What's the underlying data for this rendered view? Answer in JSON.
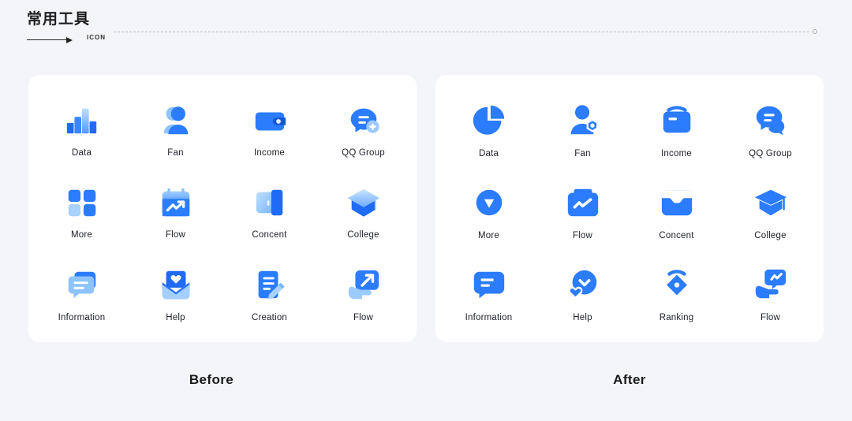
{
  "header": {
    "title": "常用工具",
    "arrow_label": "ICON",
    "end_dot": "circle-marker"
  },
  "panels": {
    "before": {
      "caption": "Before",
      "style": "gradient",
      "icons": [
        {
          "label": "Data",
          "icon": "bar-chart-icon"
        },
        {
          "label": "Fan",
          "icon": "user-person-icon"
        },
        {
          "label": "Income",
          "icon": "wallet-icon"
        },
        {
          "label": "QQ Group",
          "icon": "chat-bubble-plus-icon"
        },
        {
          "label": "More",
          "icon": "grid-squares-icon"
        },
        {
          "label": "Flow",
          "icon": "calendar-trend-icon"
        },
        {
          "label": "Concent",
          "icon": "door-open-icon"
        },
        {
          "label": "College",
          "icon": "graduation-cap-icon"
        },
        {
          "label": "Information",
          "icon": "chat-stack-icon"
        },
        {
          "label": "Help",
          "icon": "envelope-heart-icon"
        },
        {
          "label": "Creation",
          "icon": "document-pencil-icon"
        },
        {
          "label": "Flow",
          "icon": "hand-arrow-icon"
        }
      ]
    },
    "after": {
      "caption": "After",
      "style": "flat",
      "icons": [
        {
          "label": "Data",
          "icon": "pie-chart-icon"
        },
        {
          "label": "Fan",
          "icon": "user-badge-icon"
        },
        {
          "label": "Income",
          "icon": "purse-icon"
        },
        {
          "label": "QQ Group",
          "icon": "chat-bubbles-icon"
        },
        {
          "label": "More",
          "icon": "circle-caret-down-icon"
        },
        {
          "label": "Flow",
          "icon": "folder-chart-icon"
        },
        {
          "label": "Concent",
          "icon": "inbox-tray-icon"
        },
        {
          "label": "College",
          "icon": "graduation-cap-icon"
        },
        {
          "label": "Information",
          "icon": "chat-bubble-lines-icon"
        },
        {
          "label": "Help",
          "icon": "circle-heart-icon"
        },
        {
          "label": "Ranking",
          "icon": "medal-diamond-icon"
        },
        {
          "label": "Flow",
          "icon": "hand-chart-bubble-icon"
        }
      ]
    }
  },
  "colors": {
    "background": "#f4f5f8",
    "panel": "#ffffff",
    "brand_blue": "#2b7cff",
    "brand_blue_dark": "#1f6bf5",
    "brand_blue_light": "#a9d2ff",
    "text": "#20232a"
  }
}
